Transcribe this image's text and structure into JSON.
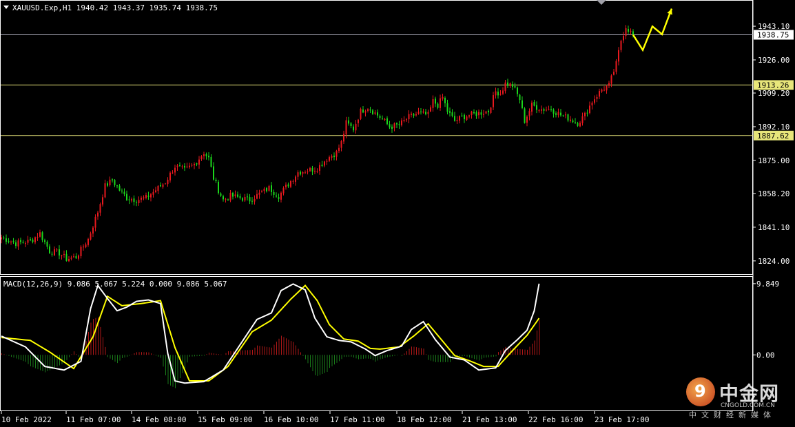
{
  "header": {
    "symbol_line": "XAUUSD.Exp,H1  1940.42 1943.37 1935.74 1938.75"
  },
  "macd": {
    "label": "MACD(12,26,9) 9.086 5.067 5.224 0.000 9.086 5.067",
    "axis_top": "9.849",
    "axis_zero": "0.00"
  },
  "watermark": {
    "brand": "中金网",
    "site": "CNGOLD.COM.CN",
    "tagline": "中文财经新媒体"
  },
  "colors": {
    "background": "#000000",
    "bull": "#e8191e",
    "bear": "#1bd61b",
    "axis": "#ffffff",
    "level_line": "#e8e67a",
    "price_line": "#a9a9b8",
    "macd_line": "#ffffff",
    "signal_line": "#ffff00",
    "arrow": "#ffff00"
  },
  "chart_data": {
    "type": "candlestick",
    "symbol": "XAUUSD.Exp",
    "timeframe": "H1",
    "ohlc_last": {
      "open": 1940.42,
      "high": 1943.37,
      "low": 1935.74,
      "close": 1938.75
    },
    "y_ticks": [
      "1943.10",
      "1926.00",
      "1909.20",
      "1892.10",
      "1875.00",
      "1858.20",
      "1841.10",
      "1824.00"
    ],
    "ylim": [
      1818,
      1955
    ],
    "x_tick_labels": [
      "10 Feb 2022",
      "11 Feb 07:00",
      "14 Feb 08:00",
      "15 Feb 09:00",
      "16 Feb 10:00",
      "17 Feb 11:00",
      "18 Feb 12:00",
      "21 Feb 13:00",
      "22 Feb 16:00",
      "23 Feb 17:00"
    ],
    "current_price": "1938.75",
    "levels": [
      "1913.26",
      "1887.62"
    ],
    "close_path": [
      [
        0,
        1836
      ],
      [
        6,
        1833
      ],
      [
        12,
        1834
      ],
      [
        16,
        1838
      ],
      [
        20,
        1829
      ],
      [
        24,
        1828
      ],
      [
        27,
        1825
      ],
      [
        31,
        1826
      ],
      [
        36,
        1835
      ],
      [
        40,
        1849
      ],
      [
        43,
        1862
      ],
      [
        46,
        1865
      ],
      [
        49,
        1860
      ],
      [
        52,
        1856
      ],
      [
        56,
        1855
      ],
      [
        60,
        1856
      ],
      [
        64,
        1860
      ],
      [
        68,
        1864
      ],
      [
        72,
        1872
      ],
      [
        76,
        1870
      ],
      [
        80,
        1873
      ],
      [
        84,
        1879
      ],
      [
        86,
        1876
      ],
      [
        88,
        1866
      ],
      [
        90,
        1860
      ],
      [
        92,
        1855
      ],
      [
        95,
        1857
      ],
      [
        99,
        1856
      ],
      [
        103,
        1855
      ],
      [
        107,
        1858
      ],
      [
        111,
        1861
      ],
      [
        115,
        1857
      ],
      [
        119,
        1863
      ],
      [
        123,
        1869
      ],
      [
        127,
        1870
      ],
      [
        131,
        1871
      ],
      [
        135,
        1876
      ],
      [
        139,
        1879
      ],
      [
        141,
        1884
      ],
      [
        143,
        1894
      ],
      [
        146,
        1891
      ],
      [
        149,
        1900
      ],
      [
        152,
        1902
      ],
      [
        155,
        1899
      ],
      [
        158,
        1896
      ],
      [
        161,
        1892
      ],
      [
        165,
        1893
      ],
      [
        169,
        1897
      ],
      [
        173,
        1899
      ],
      [
        177,
        1898
      ],
      [
        179,
        1905
      ],
      [
        181,
        1903
      ],
      [
        183,
        1907
      ],
      [
        185,
        1900
      ],
      [
        188,
        1895
      ],
      [
        191,
        1897
      ],
      [
        194,
        1898
      ],
      [
        198,
        1899
      ],
      [
        202,
        1900
      ],
      [
        205,
        1910
      ],
      [
        207,
        1909
      ],
      [
        209,
        1914
      ],
      [
        212,
        1913
      ],
      [
        215,
        1906
      ],
      [
        217,
        1895
      ],
      [
        220,
        1903
      ],
      [
        224,
        1901
      ],
      [
        228,
        1901
      ],
      [
        232,
        1898
      ],
      [
        236,
        1896
      ],
      [
        239,
        1894
      ],
      [
        242,
        1898
      ],
      [
        245,
        1905
      ],
      [
        249,
        1911
      ],
      [
        252,
        1913
      ],
      [
        255,
        1924
      ],
      [
        257,
        1936
      ],
      [
        259,
        1943
      ],
      [
        261,
        1940
      ],
      [
        262,
        1938.75
      ]
    ],
    "forecast_arrow": [
      [
        262,
        1938.75
      ],
      [
        266,
        1931
      ],
      [
        270,
        1943
      ],
      [
        274,
        1939
      ],
      [
        278,
        1952
      ]
    ],
    "macd": {
      "ylim": [
        -7.5,
        10.6
      ],
      "histogram_bars": 256,
      "macd_line": [
        [
          0,
          2.6
        ],
        [
          10,
          1.1
        ],
        [
          18,
          -1.6
        ],
        [
          26,
          -2.1
        ],
        [
          33,
          -0.9
        ],
        [
          37,
          6.4
        ],
        [
          40,
          9.6
        ],
        [
          44,
          7.8
        ],
        [
          48,
          6.1
        ],
        [
          52,
          6.6
        ],
        [
          56,
          7.4
        ],
        [
          61,
          7.6
        ],
        [
          66,
          7.1
        ],
        [
          69,
          0.2
        ],
        [
          72,
          -3.6
        ],
        [
          76,
          -3.9
        ],
        [
          84,
          -3.7
        ],
        [
          92,
          -2.1
        ],
        [
          100,
          1.9
        ],
        [
          106,
          4.9
        ],
        [
          112,
          5.8
        ],
        [
          116,
          8.9
        ],
        [
          121,
          9.8
        ],
        [
          126,
          9.0
        ],
        [
          130,
          5.1
        ],
        [
          135,
          2.5
        ],
        [
          140,
          2.0
        ],
        [
          145,
          1.8
        ],
        [
          151,
          0.8
        ],
        [
          155,
          -0.1
        ],
        [
          160,
          0.6
        ],
        [
          166,
          1.2
        ],
        [
          170,
          3.5
        ],
        [
          175,
          4.6
        ],
        [
          180,
          2.1
        ],
        [
          186,
          -0.3
        ],
        [
          192,
          -0.7
        ],
        [
          198,
          -2.1
        ],
        [
          205,
          -1.8
        ],
        [
          209,
          0.6
        ],
        [
          214,
          2.1
        ],
        [
          218,
          3.4
        ],
        [
          221,
          6.1
        ],
        [
          223,
          9.849
        ]
      ],
      "signal_line": [
        [
          0,
          2.4
        ],
        [
          12,
          2.0
        ],
        [
          20,
          0.4
        ],
        [
          30,
          -1.9
        ],
        [
          38,
          2.5
        ],
        [
          44,
          8.1
        ],
        [
          50,
          6.8
        ],
        [
          58,
          7.1
        ],
        [
          66,
          7.5
        ],
        [
          72,
          1.0
        ],
        [
          78,
          -3.6
        ],
        [
          86,
          -3.6
        ],
        [
          94,
          -1.6
        ],
        [
          104,
          3.2
        ],
        [
          112,
          4.8
        ],
        [
          120,
          7.7
        ],
        [
          126,
          9.6
        ],
        [
          131,
          7.5
        ],
        [
          136,
          4.2
        ],
        [
          142,
          2.2
        ],
        [
          148,
          1.9
        ],
        [
          153,
          0.9
        ],
        [
          157,
          0.8
        ],
        [
          165,
          1.1
        ],
        [
          171,
          2.6
        ],
        [
          177,
          4.3
        ],
        [
          182,
          2.3
        ],
        [
          188,
          -0.1
        ],
        [
          194,
          -0.8
        ],
        [
          200,
          -1.6
        ],
        [
          206,
          -1.6
        ],
        [
          212,
          0.6
        ],
        [
          218,
          2.7
        ],
        [
          223,
          5.067
        ]
      ]
    }
  }
}
